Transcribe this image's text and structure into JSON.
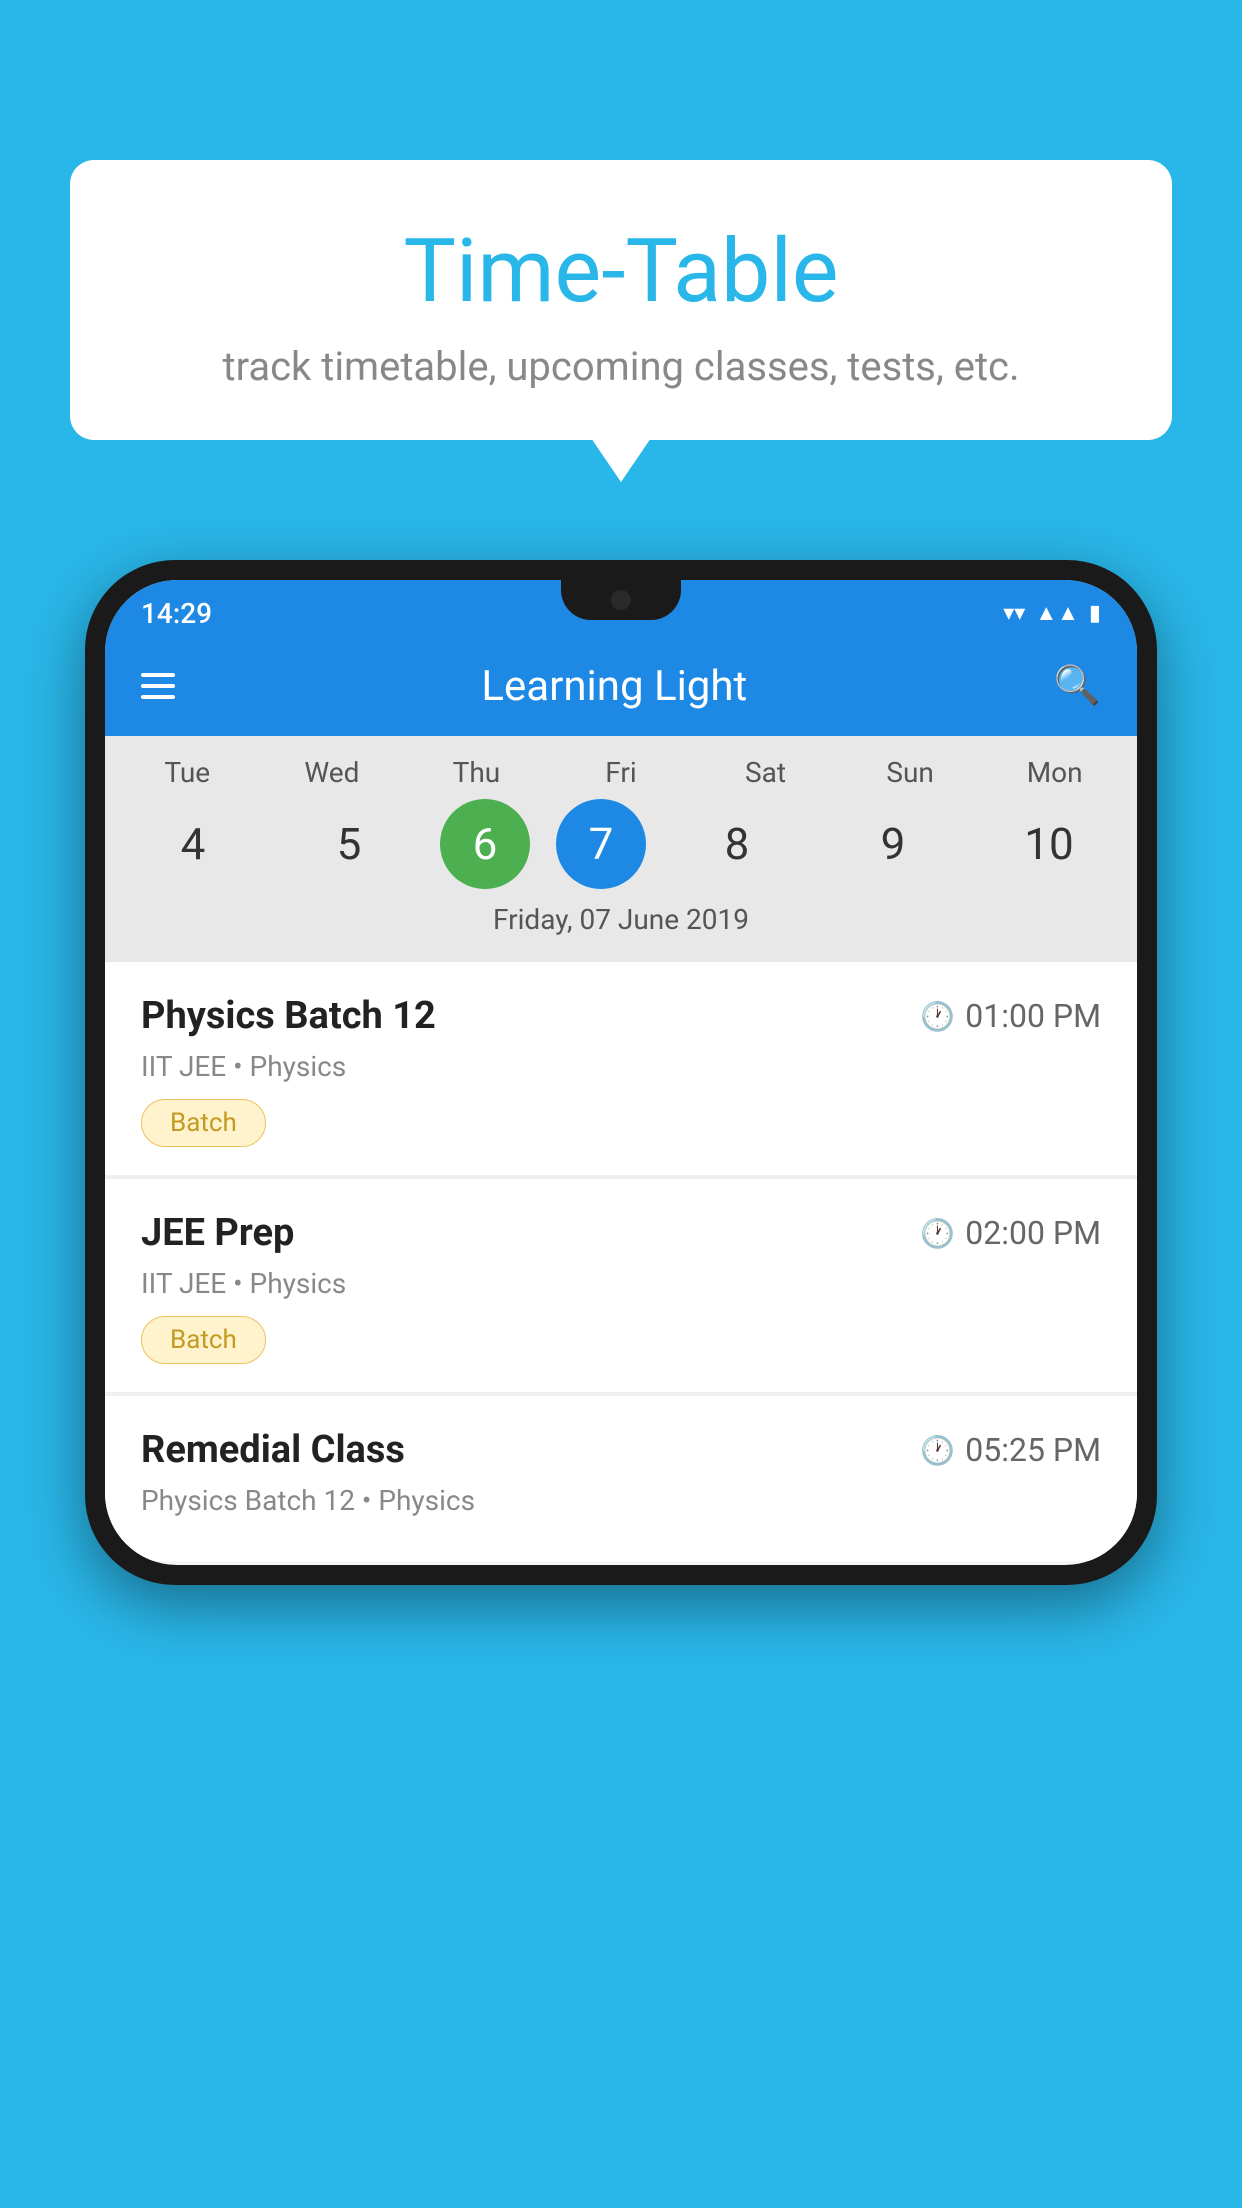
{
  "background": "#29b6e8",
  "bubble": {
    "title": "Time-Table",
    "subtitle": "track timetable, upcoming classes, tests, etc."
  },
  "phone": {
    "status_bar": {
      "time": "14:29"
    },
    "app_bar": {
      "title": "Learning Light"
    },
    "calendar": {
      "day_headers": [
        "Tue",
        "Wed",
        "Thu",
        "Fri",
        "Sat",
        "Sun",
        "Mon"
      ],
      "day_numbers": [
        {
          "num": "4",
          "state": "normal"
        },
        {
          "num": "5",
          "state": "normal"
        },
        {
          "num": "6",
          "state": "today"
        },
        {
          "num": "7",
          "state": "selected"
        },
        {
          "num": "8",
          "state": "normal"
        },
        {
          "num": "9",
          "state": "normal"
        },
        {
          "num": "10",
          "state": "normal"
        }
      ],
      "date_label": "Friday, 07 June 2019"
    },
    "schedule": [
      {
        "title": "Physics Batch 12",
        "time": "01:00 PM",
        "meta": "IIT JEE • Physics",
        "badge": "Batch"
      },
      {
        "title": "JEE Prep",
        "time": "02:00 PM",
        "meta": "IIT JEE • Physics",
        "badge": "Batch"
      },
      {
        "title": "Remedial Class",
        "time": "05:25 PM",
        "meta": "Physics Batch 12 • Physics",
        "badge": null
      }
    ]
  }
}
